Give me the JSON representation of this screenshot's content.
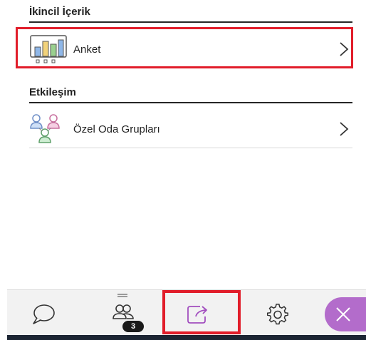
{
  "sections": {
    "secondary_content": {
      "heading": "İkincil İçerik",
      "items": [
        {
          "label": "Anket",
          "icon": "poll-chart-icon"
        }
      ]
    },
    "interaction": {
      "heading": "Etkileşim",
      "items": [
        {
          "label": "Özel Oda Grupları",
          "icon": "breakout-groups-icon"
        }
      ]
    }
  },
  "tab_bar": {
    "tabs": [
      {
        "name": "chat",
        "icon": "chat-bubble-icon"
      },
      {
        "name": "attendees",
        "icon": "attendees-icon",
        "badge": "3"
      },
      {
        "name": "share-content",
        "icon": "share-icon",
        "active": true
      },
      {
        "name": "settings",
        "icon": "gear-icon"
      }
    ],
    "close_icon": "close-icon"
  },
  "colors": {
    "highlight": "#e11d2a",
    "active_tab": "#a24fbf",
    "close_button_bg": "#b36ccb",
    "divider": "#262626"
  }
}
